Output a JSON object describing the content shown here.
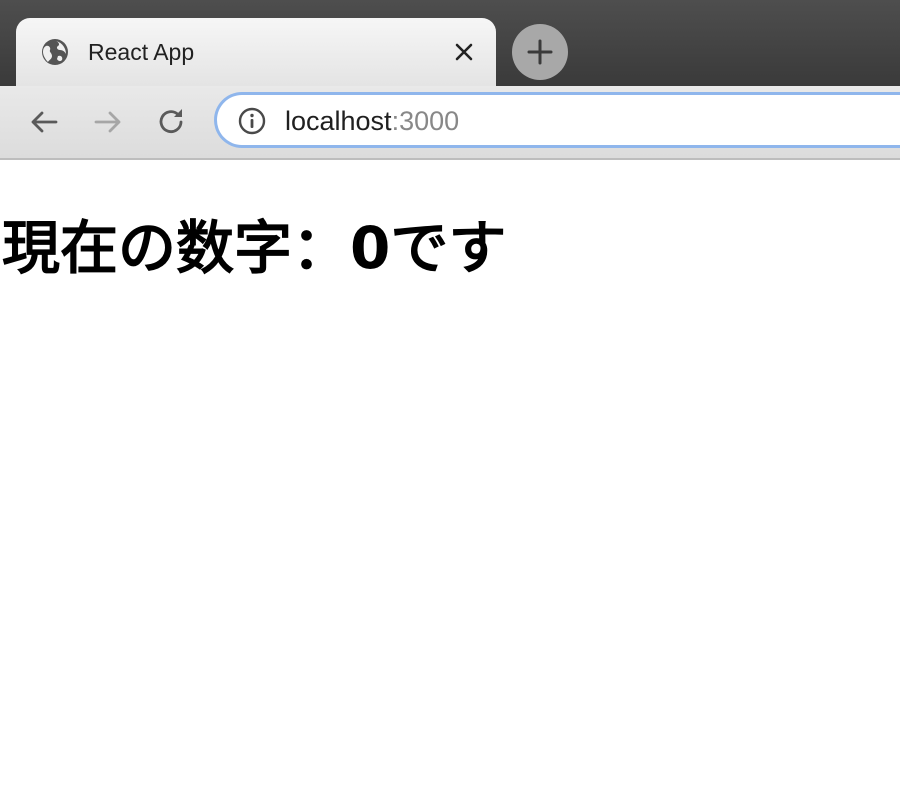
{
  "browser": {
    "tab": {
      "title": "React App",
      "icon": "globe-icon"
    },
    "new_tab_icon": "plus-icon",
    "nav": {
      "back_icon": "arrow-left-icon",
      "forward_icon": "arrow-right-icon",
      "reload_icon": "reload-icon"
    },
    "address": {
      "icon": "info-icon",
      "host": "localhost",
      "port": ":3000"
    }
  },
  "page": {
    "heading": "現在の数字：0です"
  },
  "colors": {
    "tabstrip": "#3f3f3f",
    "active_tab": "#efefef",
    "omnibox_focus": "#8fb6ec",
    "port_text": "#888888"
  }
}
